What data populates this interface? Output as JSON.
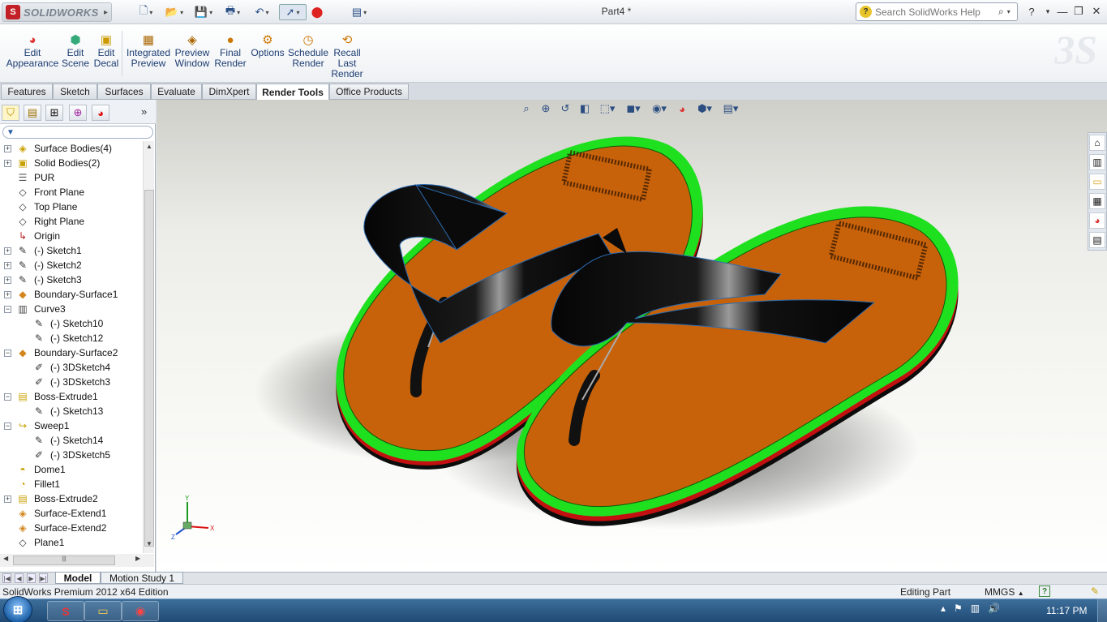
{
  "app": {
    "brand": "SOLIDWORKS",
    "document_title": "Part4 *",
    "search_placeholder": "Search SolidWorks Help"
  },
  "ribbon": {
    "buttons": [
      {
        "label": "Edit\nAppearance",
        "icon": "appearance-icon"
      },
      {
        "label": "Edit\nScene",
        "icon": "scene-icon"
      },
      {
        "label": "Edit\nDecal",
        "icon": "decal-icon"
      },
      {
        "label": "Integrated\nPreview",
        "icon": "integrated-preview-icon"
      },
      {
        "label": "Preview\nWindow",
        "icon": "preview-window-icon"
      },
      {
        "label": "Final\nRender",
        "icon": "final-render-icon"
      },
      {
        "label": "Options",
        "icon": "options-icon"
      },
      {
        "label": "Schedule\nRender",
        "icon": "schedule-render-icon"
      },
      {
        "label": "Recall\nLast\nRender",
        "icon": "recall-render-icon"
      }
    ]
  },
  "tabs": [
    "Features",
    "Sketch",
    "Surfaces",
    "Evaluate",
    "DimXpert",
    "Render Tools",
    "Office Products"
  ],
  "active_tab": "Render Tools",
  "tree": [
    {
      "label": "Surface Bodies(4)",
      "expander": "+",
      "icon": "surface-bodies-icon"
    },
    {
      "label": "Solid Bodies(2)",
      "expander": "+",
      "icon": "solid-bodies-icon"
    },
    {
      "label": "PUR",
      "expander": "",
      "icon": "material-icon"
    },
    {
      "label": "Front Plane",
      "expander": "",
      "icon": "plane-icon"
    },
    {
      "label": "Top Plane",
      "expander": "",
      "icon": "plane-icon"
    },
    {
      "label": "Right Plane",
      "expander": "",
      "icon": "plane-icon"
    },
    {
      "label": "Origin",
      "expander": "",
      "icon": "origin-icon"
    },
    {
      "label": "(-) Sketch1",
      "expander": "+",
      "icon": "sketch-icon"
    },
    {
      "label": "(-) Sketch2",
      "expander": "+",
      "icon": "sketch-icon"
    },
    {
      "label": "(-) Sketch3",
      "expander": "+",
      "icon": "sketch-icon"
    },
    {
      "label": "Boundary-Surface1",
      "expander": "+",
      "icon": "boundary-surface-icon"
    },
    {
      "label": "Curve3",
      "expander": "−",
      "icon": "curve-icon"
    },
    {
      "label": "(-) Sketch10",
      "expander": "",
      "icon": "sketch-icon",
      "child": true
    },
    {
      "label": "(-) Sketch12",
      "expander": "",
      "icon": "sketch-icon",
      "child": true
    },
    {
      "label": "Boundary-Surface2",
      "expander": "−",
      "icon": "boundary-surface-icon"
    },
    {
      "label": "(-) 3DSketch4",
      "expander": "",
      "icon": "3dsketch-icon",
      "child": true
    },
    {
      "label": "(-) 3DSketch3",
      "expander": "",
      "icon": "3dsketch-icon",
      "child": true
    },
    {
      "label": "Boss-Extrude1",
      "expander": "−",
      "icon": "extrude-icon"
    },
    {
      "label": "(-) Sketch13",
      "expander": "",
      "icon": "sketch-icon",
      "child": true
    },
    {
      "label": "Sweep1",
      "expander": "−",
      "icon": "sweep-icon"
    },
    {
      "label": "(-) Sketch14",
      "expander": "",
      "icon": "sketch-icon",
      "child": true
    },
    {
      "label": "(-) 3DSketch5",
      "expander": "",
      "icon": "3dsketch-icon",
      "child": true
    },
    {
      "label": "Dome1",
      "expander": "",
      "icon": "dome-icon"
    },
    {
      "label": "Fillet1",
      "expander": "",
      "icon": "fillet-icon"
    },
    {
      "label": "Boss-Extrude2",
      "expander": "+",
      "icon": "extrude-icon"
    },
    {
      "label": "Surface-Extend1",
      "expander": "",
      "icon": "surface-extend-icon"
    },
    {
      "label": "Surface-Extend2",
      "expander": "",
      "icon": "surface-extend-icon"
    },
    {
      "label": "Plane1",
      "expander": "",
      "icon": "plane-icon"
    }
  ],
  "bottom_tabs": [
    "Model",
    "Motion Study 1"
  ],
  "active_bottom_tab": "Model",
  "status": {
    "edition": "SolidWorks Premium 2012 x64 Edition",
    "mode": "Editing Part",
    "units": "MMGS"
  },
  "taskbar": {
    "clock": "11:17 PM"
  },
  "colors": {
    "sole_top": "#c8620a",
    "sole_rim": "#1fe01f",
    "sole_base": "#d11414",
    "strap": "#0d0d0d"
  }
}
